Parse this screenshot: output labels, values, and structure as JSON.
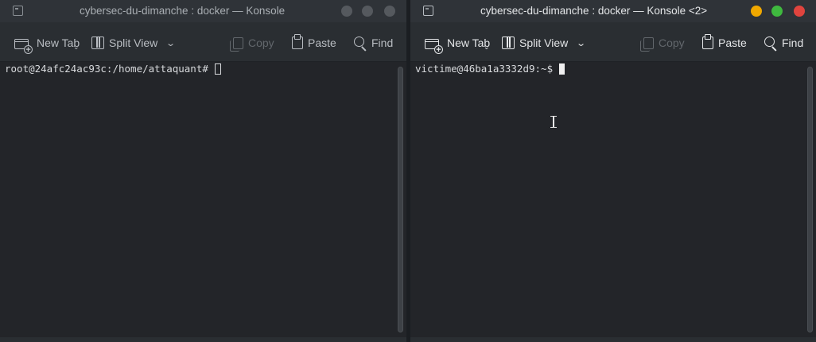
{
  "windows": [
    {
      "title": "cybersec-du-dimanche : docker — Konsole",
      "active": false,
      "toolbar": {
        "new_tab": "New Tab",
        "split_view": "Split View",
        "copy": "Copy",
        "paste": "Paste",
        "find": "Find"
      },
      "prompt": "root@24afc24ac93c:/home/attaquant#"
    },
    {
      "title": "cybersec-du-dimanche : docker — Konsole <2>",
      "active": true,
      "toolbar": {
        "new_tab": "New Tab",
        "split_view": "Split View",
        "copy": "Copy",
        "paste": "Paste",
        "find": "Find"
      },
      "prompt": "victime@46ba1a3332d9:~$"
    }
  ],
  "colors": {
    "close": "#e0443e",
    "minimize": "#f0a800",
    "maximize": "#3fb93f",
    "terminal_bg": "#232529"
  },
  "icons": [
    "app-icon",
    "new-tab-icon",
    "split-view-icon",
    "copy-icon",
    "paste-icon",
    "find-icon",
    "chevron-down-icon",
    "text-cursor-icon"
  ]
}
